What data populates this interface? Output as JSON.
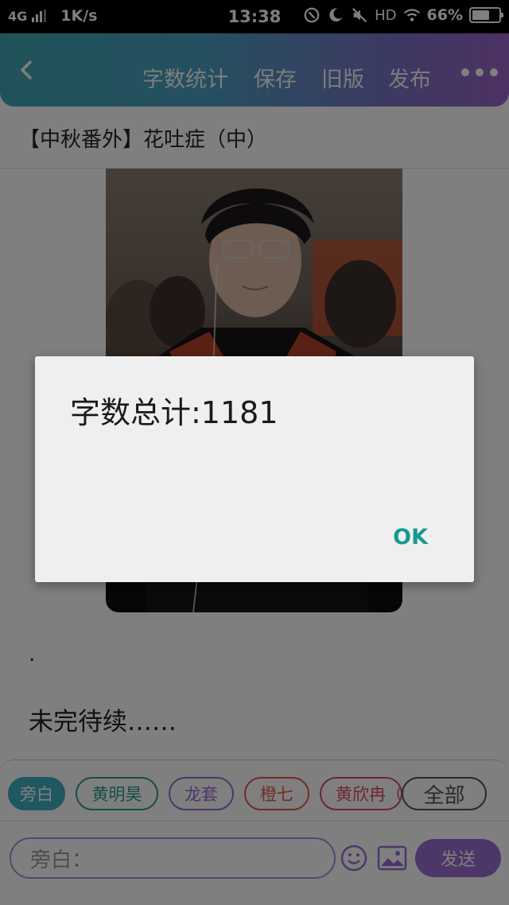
{
  "status_bar": {
    "network": "4G",
    "speed": "1K/s",
    "time": "13:38",
    "hd": "HD",
    "battery": "66%",
    "battery_level": 0.66,
    "icons": [
      "nfc-icon",
      "moon-icon",
      "mute-icon",
      "wifi-icon",
      "battery-icon"
    ]
  },
  "toolbar": {
    "back_icon": "chevron-left-icon",
    "items": [
      "字数统计",
      "保存",
      "旧版",
      "发布"
    ],
    "more_icon": "more-dots-icon",
    "colors": {
      "start": "#3fa7b3",
      "end": "#9b64c8"
    }
  },
  "document": {
    "title": "【中秋番外】花吐症（中）",
    "dot": ".",
    "body": "未完待续……"
  },
  "characters": {
    "chips": [
      "旁白",
      "黄明昊",
      "龙套",
      "橙七",
      "黄欣冉（",
      "全部"
    ],
    "chip_colors": [
      "#3fb0bf",
      "#2a9d8f",
      "#9b6cd0",
      "#e05a4f",
      "#d94a6a",
      "#555555"
    ],
    "active_index": 0
  },
  "composer": {
    "placeholder": "旁白：",
    "emoji_icon": "emoji-icon",
    "image_icon": "image-icon",
    "send_label": "发送"
  },
  "dialog": {
    "message": "字数总计:1181",
    "ok_label": "OK",
    "ok_color": "#179b8f"
  }
}
